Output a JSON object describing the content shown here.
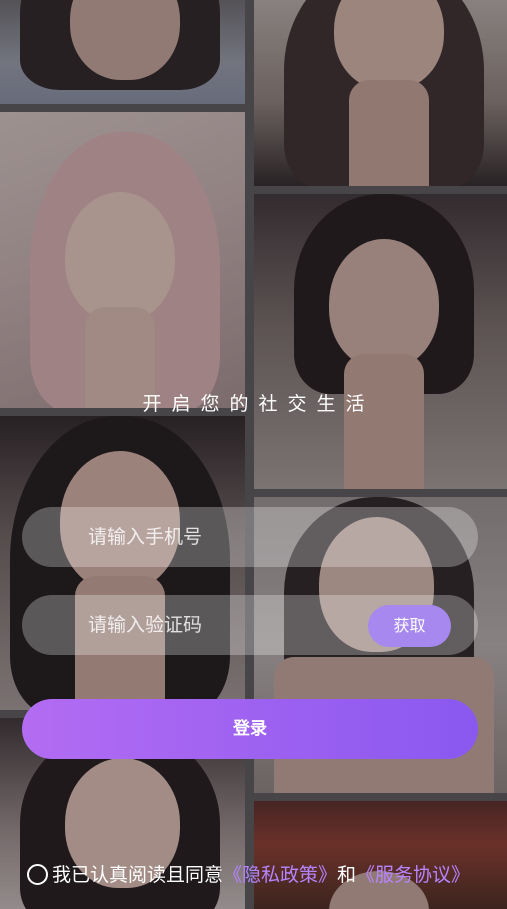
{
  "tagline": "开启您的社交生活",
  "phone_field": {
    "placeholder": "请输入手机号",
    "value": ""
  },
  "code_field": {
    "placeholder": "请输入验证码",
    "value": ""
  },
  "get_code_label": "获取",
  "login_label": "登录",
  "agreement": {
    "prefix": "我已认真阅读且同意",
    "privacy_link": "《隐私政策》",
    "conjunction": "和",
    "service_link": "《服务协议》"
  },
  "colors": {
    "accent": "#a688ef",
    "login_gradient_start": "#b36cf2",
    "login_gradient_end": "#8a58f0",
    "link": "#b784ff"
  },
  "background": {
    "photo_tiles": 8
  }
}
